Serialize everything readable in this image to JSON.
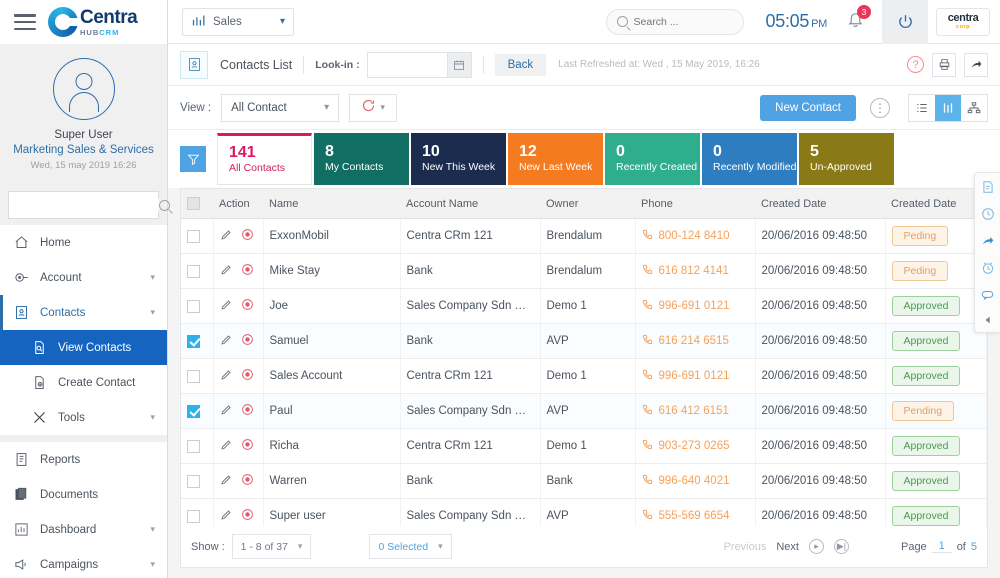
{
  "brand": {
    "name": "Centra",
    "sub_hub": "HUB",
    "sub_crm": "CRM",
    "corner_b1": "centra",
    "corner_b2": "corp"
  },
  "topbar": {
    "module": "Sales",
    "search_placeholder": "Search ...",
    "search_value": "",
    "time": "05:05",
    "ampm": "PM",
    "notification_count": "3"
  },
  "profile": {
    "name": "Super User",
    "role": "Marketing Sales & Services",
    "datetime": "Wed, 15 may 2019 16:26",
    "search_placeholder": ""
  },
  "sidebar": {
    "items": [
      {
        "label": "Home",
        "icon": "home-icon",
        "caret": false
      },
      {
        "label": "Account",
        "icon": "account-icon",
        "caret": true
      },
      {
        "label": "Contacts",
        "icon": "contacts-icon",
        "caret": true
      },
      {
        "label": "View Contacts",
        "icon": "view-contacts-icon",
        "caret": false
      },
      {
        "label": "Create Contact",
        "icon": "create-contact-icon",
        "caret": false
      },
      {
        "label": "Tools",
        "icon": "tools-icon",
        "caret": true
      },
      {
        "label": "Reports",
        "icon": "reports-icon",
        "caret": false
      },
      {
        "label": "Documents",
        "icon": "documents-icon",
        "caret": false
      },
      {
        "label": "Dashboard",
        "icon": "dashboard-icon",
        "caret": true
      },
      {
        "label": "Campaigns",
        "icon": "campaigns-icon",
        "caret": true
      }
    ]
  },
  "breadcrumb": {
    "title": "Contacts List",
    "lookin_label": "Look-in :",
    "lookin_value": "",
    "back_label": "Back",
    "last_refreshed": "Last Refreshed at: Wed , 15 May 2019, 16:26"
  },
  "viewbar": {
    "view_label": "View :",
    "view_value": "All Contact",
    "new_contact_label": "New Contact"
  },
  "tiles": [
    {
      "num": "141",
      "cap": "All Contacts",
      "color": "#ffffff",
      "accent": "#d81b60"
    },
    {
      "num": "8",
      "cap": "My Contacts",
      "color": "#116e62"
    },
    {
      "num": "10",
      "cap": "New This Week",
      "color": "#1b2c4e"
    },
    {
      "num": "12",
      "cap": "New Last Week",
      "color": "#f47b20"
    },
    {
      "num": "0",
      "cap": "Recently Created",
      "color": "#2fae8e"
    },
    {
      "num": "0",
      "cap": "Recently Modified",
      "color": "#2f7dc1"
    },
    {
      "num": "5",
      "cap": "Un-Approved",
      "color": "#8a7a17"
    }
  ],
  "table": {
    "columns": [
      "",
      "Action",
      "Name",
      "Account Name",
      "Owner",
      "Phone",
      "Created Date",
      "Created Date"
    ],
    "rows": [
      {
        "checked": false,
        "name": "ExxonMobil",
        "account": "Centra CRm 121",
        "owner": "Brendalum",
        "phone": "800-124 8410",
        "created": "20/06/2016  09:48:50",
        "status": "Peding",
        "status_kind": "pending"
      },
      {
        "checked": false,
        "name": "Mike Stay",
        "account": "Bank",
        "owner": "Brendalum",
        "phone": "616 812 4141",
        "created": "20/06/2016  09:48:50",
        "status": "Peding",
        "status_kind": "pending"
      },
      {
        "checked": false,
        "name": "Joe",
        "account": "Sales Company Sdn Bhd",
        "owner": "Demo 1",
        "phone": "996-691 0121",
        "created": "20/06/2016  09:48:50",
        "status": "Approved",
        "status_kind": "approved"
      },
      {
        "checked": true,
        "name": "Samuel",
        "account": "Bank",
        "owner": "AVP",
        "phone": "616 214 6515",
        "created": "20/06/2016  09:48:50",
        "status": "Approved",
        "status_kind": "approved"
      },
      {
        "checked": false,
        "name": "Sales Account",
        "account": "Centra CRm 121",
        "owner": "Demo 1",
        "phone": "996-691 0121",
        "created": "20/06/2016  09:48:50",
        "status": "Approved",
        "status_kind": "approved"
      },
      {
        "checked": true,
        "name": "Paul",
        "account": "Sales Company Sdn Bhd",
        "owner": "AVP",
        "phone": "616 412 6151",
        "created": "20/06/2016  09:48:50",
        "status": "Pending",
        "status_kind": "pending"
      },
      {
        "checked": false,
        "name": "Richa",
        "account": "Centra CRm 121",
        "owner": "Demo 1",
        "phone": "903-273 0265",
        "created": "20/06/2016  09:48:50",
        "status": "Approved",
        "status_kind": "approved"
      },
      {
        "checked": false,
        "name": "Warren",
        "account": "Bank",
        "owner": "Bank",
        "phone": "996-640 4021",
        "created": "20/06/2016  09:48:50",
        "status": "Approved",
        "status_kind": "approved"
      },
      {
        "checked": false,
        "name": "Super user",
        "account": "Sales Company Sdn Bhd",
        "owner": "AVP",
        "phone": "555-569 6654",
        "created": "20/06/2016  09:48:50",
        "status": "Approved",
        "status_kind": "approved"
      }
    ]
  },
  "footer": {
    "show_label": "Show :",
    "show_value": "1 - 8 of 37",
    "selected_value": "0 Selected",
    "previous_label": "Previous",
    "next_label": "Next",
    "page_label": "Page",
    "page_number": "1",
    "of_label": "of",
    "page_total": "5"
  },
  "rail": {
    "icons": [
      "notes-icon",
      "history-clock-icon",
      "share-icon",
      "reminder-alarm-icon",
      "chat-icon",
      "collapse-chevron-icon"
    ]
  }
}
